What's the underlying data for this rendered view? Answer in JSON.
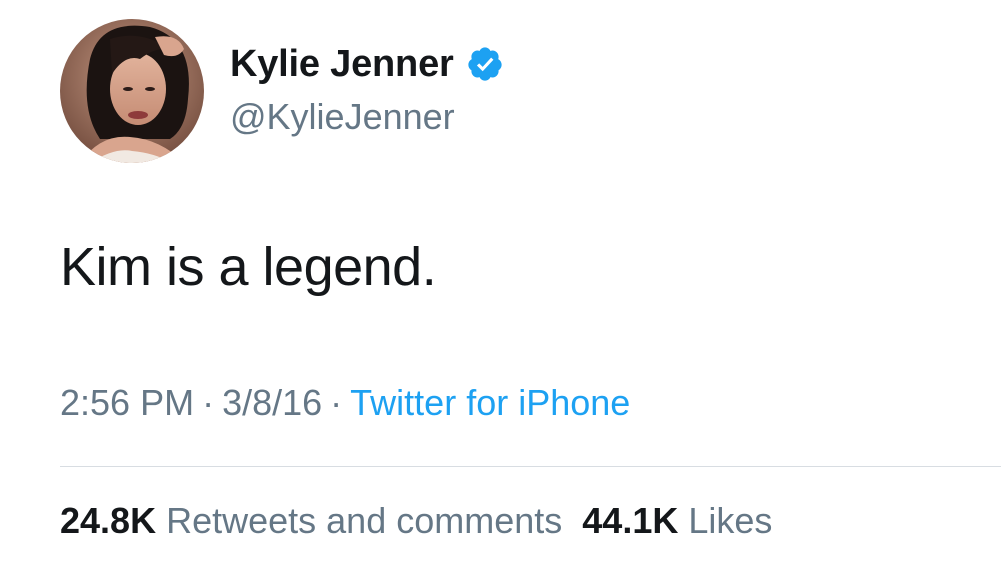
{
  "author": {
    "display_name": "Kylie Jenner",
    "handle": "@KylieJenner",
    "verified_icon": "verified-badge-icon",
    "avatar_icon": "profile-photo"
  },
  "tweet": {
    "text": "Kim is a legend."
  },
  "meta": {
    "time": "2:56 PM",
    "separator": "·",
    "date": "3/8/16",
    "source": "Twitter for iPhone"
  },
  "stats": {
    "retweets_count": "24.8K",
    "retweets_label": "Retweets and comments",
    "likes_count": "44.1K",
    "likes_label": "Likes"
  },
  "colors": {
    "text_primary": "#14171a",
    "text_secondary": "#657786",
    "link_blue": "#1da1f2",
    "divider": "#d8dde2"
  }
}
